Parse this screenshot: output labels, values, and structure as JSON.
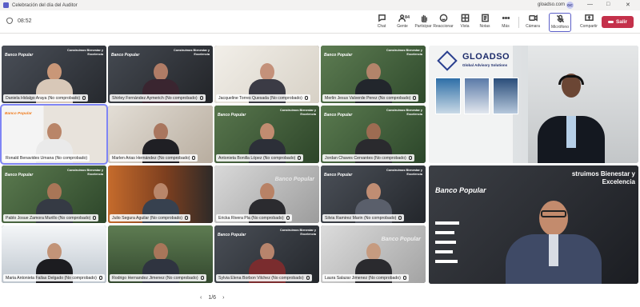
{
  "window": {
    "title": "Celebración del día del Auditor",
    "host": "gloadso.com",
    "avatar": "GC",
    "controls": [
      "—",
      "□",
      "✕"
    ]
  },
  "toolbar": {
    "timer": "08:52",
    "participants_count": "84",
    "tools": [
      {
        "label": "Chat",
        "icon": "chat-icon"
      },
      {
        "label": "Gente",
        "icon": "people-icon"
      },
      {
        "label": "Participar",
        "icon": "raise-hand-icon"
      },
      {
        "label": "Reaccionar",
        "icon": "reaction-icon"
      },
      {
        "label": "Vista",
        "icon": "view-icon"
      },
      {
        "label": "Notas",
        "icon": "notes-icon"
      },
      {
        "label": "Más",
        "icon": "more-icon"
      },
      {
        "label": "Cámara",
        "icon": "camera-icon"
      },
      {
        "label": "Micrófono",
        "icon": "microphone-icon"
      },
      {
        "label": "Compartir",
        "icon": "share-icon"
      }
    ],
    "leave_label": "Salir"
  },
  "tiles": [
    {
      "name": "Daniela Hidalgo Araya (No comprobado)"
    },
    {
      "name": "Shirley Fernández Aymerich (No comprobado)"
    },
    {
      "name": "Jacqueline Torres Quesada (No comprobado)"
    },
    {
      "name": "Merlin Jesus Valverde Perez (No comprobado)"
    },
    {
      "name": "Ronald Benavides Umana (No comprobado)"
    },
    {
      "name": "Marlen Arias Hernández (No comprobado)"
    },
    {
      "name": "Antonieta Bonilla López (No comprobado)"
    },
    {
      "name": "Jordan Chaves Cervantes (No comprobado)"
    },
    {
      "name": "Pablo Josue Zamora Murillo (No comprobado)"
    },
    {
      "name": "Julio Segura Aguilar (No comprobado)"
    },
    {
      "name": "Ericka Rivera Pla (No comprobado)"
    },
    {
      "name": "Silvia Ramirez Marin (No comprobado)"
    },
    {
      "name": "Maria Antonieta Fallas Delgado (No comprobado)"
    },
    {
      "name": "Rodrigo Hernandez Jimenez (No comprobado)"
    },
    {
      "name": "Sylvia Elena Borbon Vilchez (No comprobado)"
    },
    {
      "name": "Laura Salazar Jimenez (No comprobado)"
    }
  ],
  "branding": {
    "banco": "Banco Popular",
    "banner": "Construimos Bienestar y Excelencia",
    "gloadso": "GLOADSO",
    "gloadso_sub": "Global Advisory Solutions",
    "big_banner": "struimos Bienestar y Excelencia"
  },
  "pager": {
    "text": "1/6",
    "prev": "‹",
    "next": "›"
  }
}
